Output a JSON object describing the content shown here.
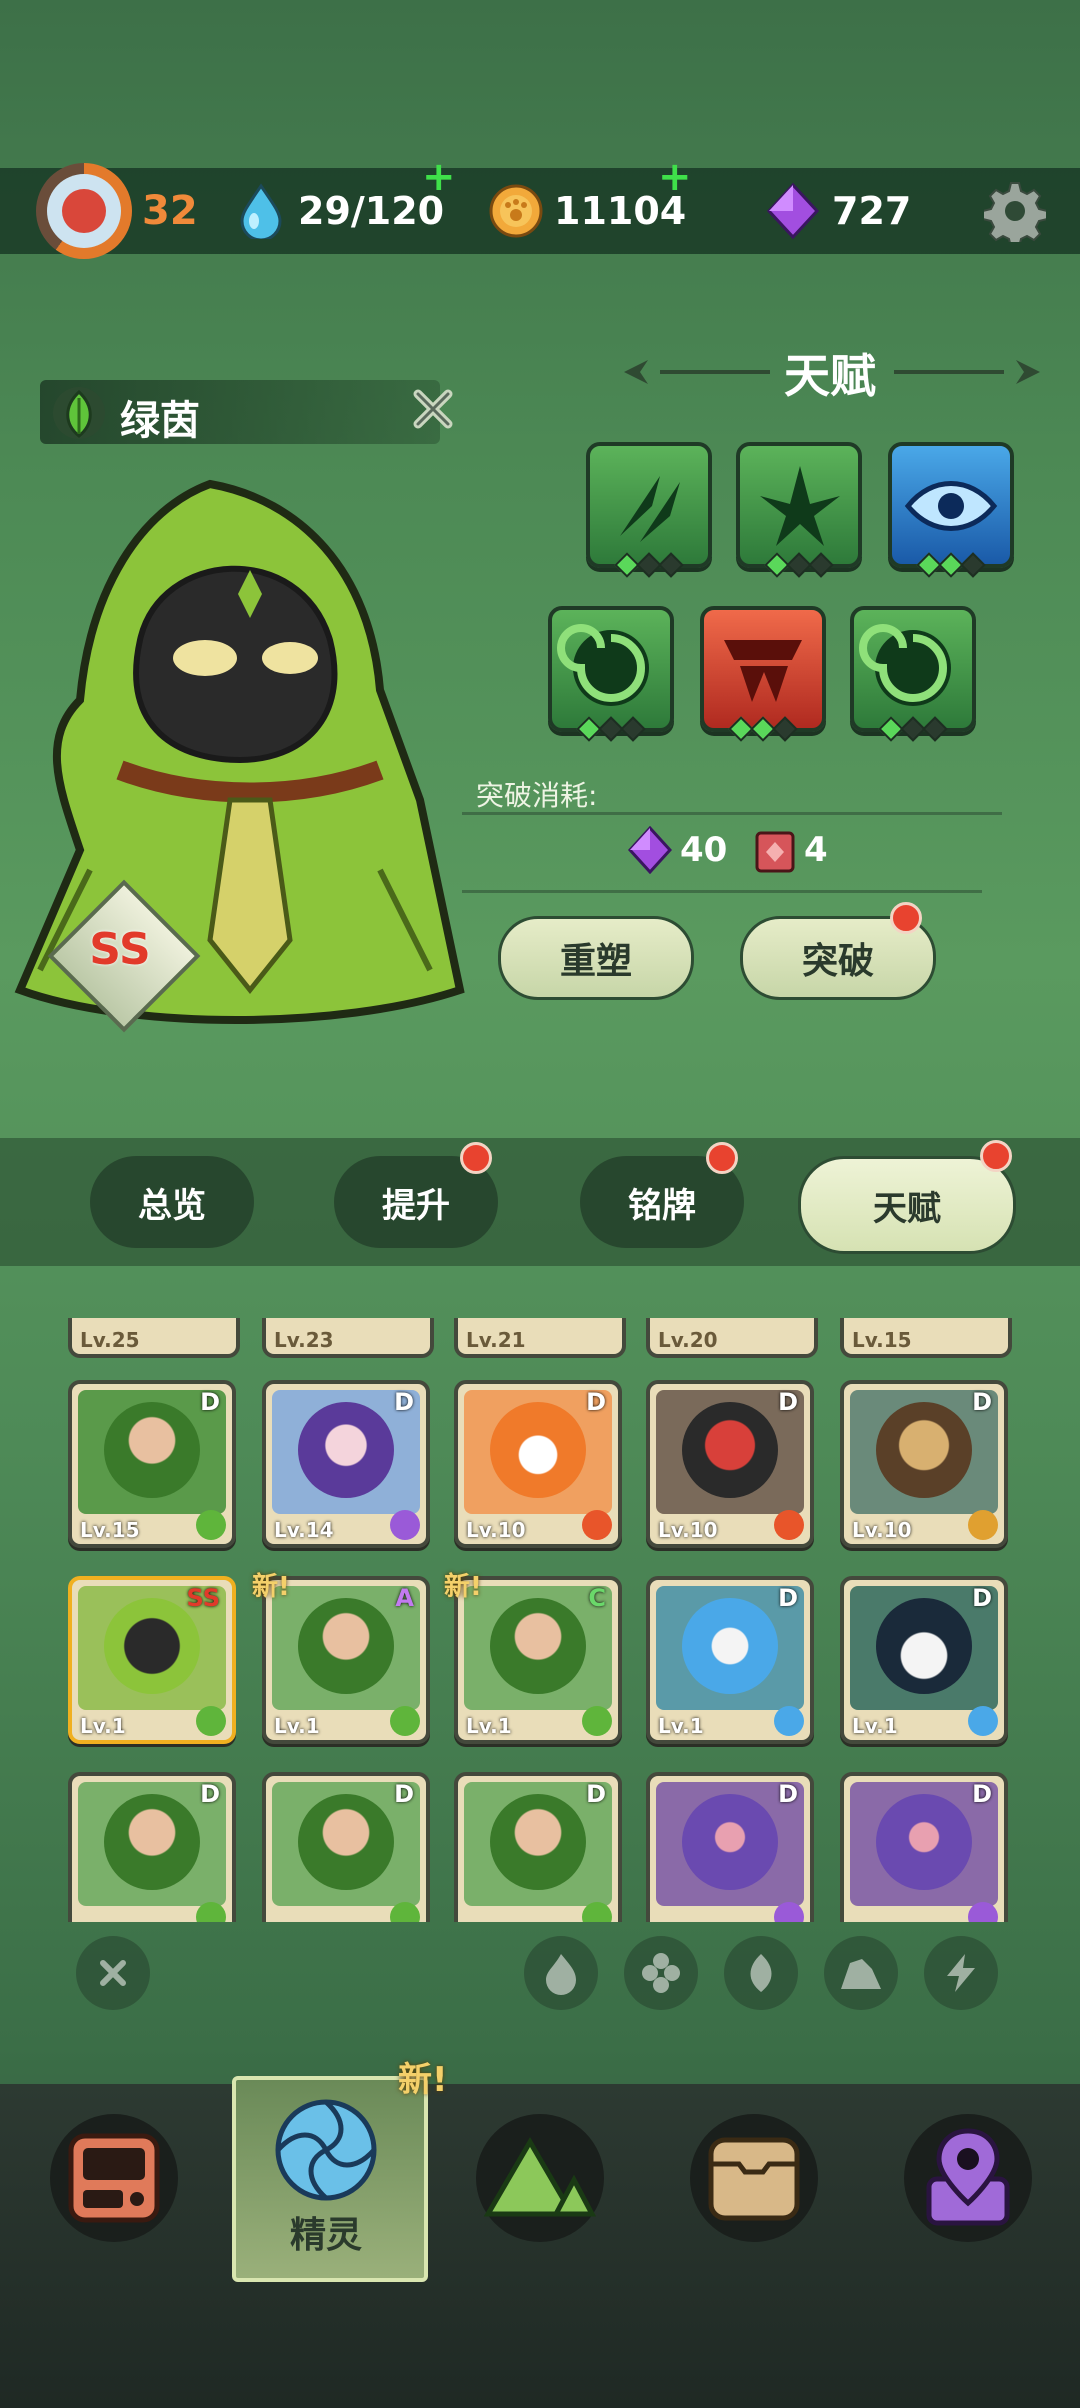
{
  "topbar": {
    "player_level": "32",
    "energy": "29/120",
    "coins": "11104",
    "gems": "727",
    "plus": "+"
  },
  "pet": {
    "name": "绿茵",
    "rank": "SS"
  },
  "talent": {
    "title": "天赋",
    "breakthrough_cost_label": "突破消耗:",
    "cost_gems": "40",
    "cost_item": "4",
    "reshape_label": "重塑",
    "breakthrough_label": "突破"
  },
  "tabs": [
    "总览",
    "提升",
    "铭牌",
    "天赋"
  ],
  "grid": {
    "top_row_levels": [
      "Lv.25",
      "Lv.23",
      "Lv.21",
      "Lv.20",
      "Lv.15"
    ],
    "rows": [
      [
        {
          "level": "Lv.15",
          "grade": "D"
        },
        {
          "level": "Lv.14",
          "grade": "D"
        },
        {
          "level": "Lv.10",
          "grade": "D"
        },
        {
          "level": "Lv.10",
          "grade": "D"
        },
        {
          "level": "Lv.10",
          "grade": "D"
        }
      ],
      [
        {
          "level": "Lv.1",
          "grade": "SS"
        },
        {
          "level": "Lv.1",
          "grade": "A"
        },
        {
          "level": "Lv.1",
          "grade": "C"
        },
        {
          "level": "Lv.1",
          "grade": "D"
        },
        {
          "level": "Lv.1",
          "grade": "D"
        }
      ],
      [
        {
          "level": "",
          "grade": "D"
        },
        {
          "level": "",
          "grade": "D"
        },
        {
          "level": "",
          "grade": "D"
        },
        {
          "level": "",
          "grade": "D"
        },
        {
          "level": "",
          "grade": "D"
        }
      ]
    ],
    "new_label": "新!"
  },
  "nav": {
    "spirit_label": "精灵",
    "new_label": "新!"
  },
  "colors": {
    "grass": "#5fb53b",
    "fire": "#e8552a",
    "ice": "#4aa8e8",
    "electric": "#9a5ad8",
    "earth": "#e0a030"
  }
}
